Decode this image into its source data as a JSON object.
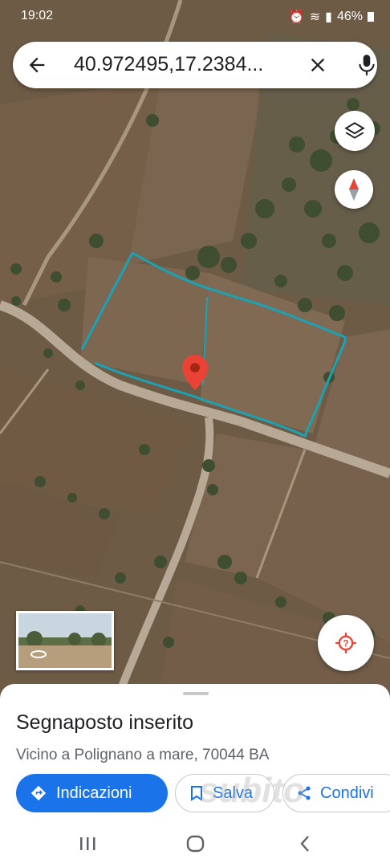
{
  "status_bar": {
    "time": "19:02",
    "battery": "46%"
  },
  "search": {
    "query": "40.972495,17.2384...",
    "icons": [
      "back-arrow-icon",
      "close-icon",
      "microphone-icon"
    ]
  },
  "map": {
    "controls": [
      "layers-icon",
      "compass-icon",
      "my-location-icon"
    ],
    "pin_color": "#ea4335",
    "boundary_color": "#19a3b5"
  },
  "place": {
    "title": "Segnaposto inserito",
    "address": "Vicino a Polignano a mare, 70044 BA"
  },
  "actions": {
    "directions": "Indicazioni",
    "save": "Salva",
    "share": "Condivi"
  },
  "watermark": "subito",
  "accent_color": "#1a73e8"
}
